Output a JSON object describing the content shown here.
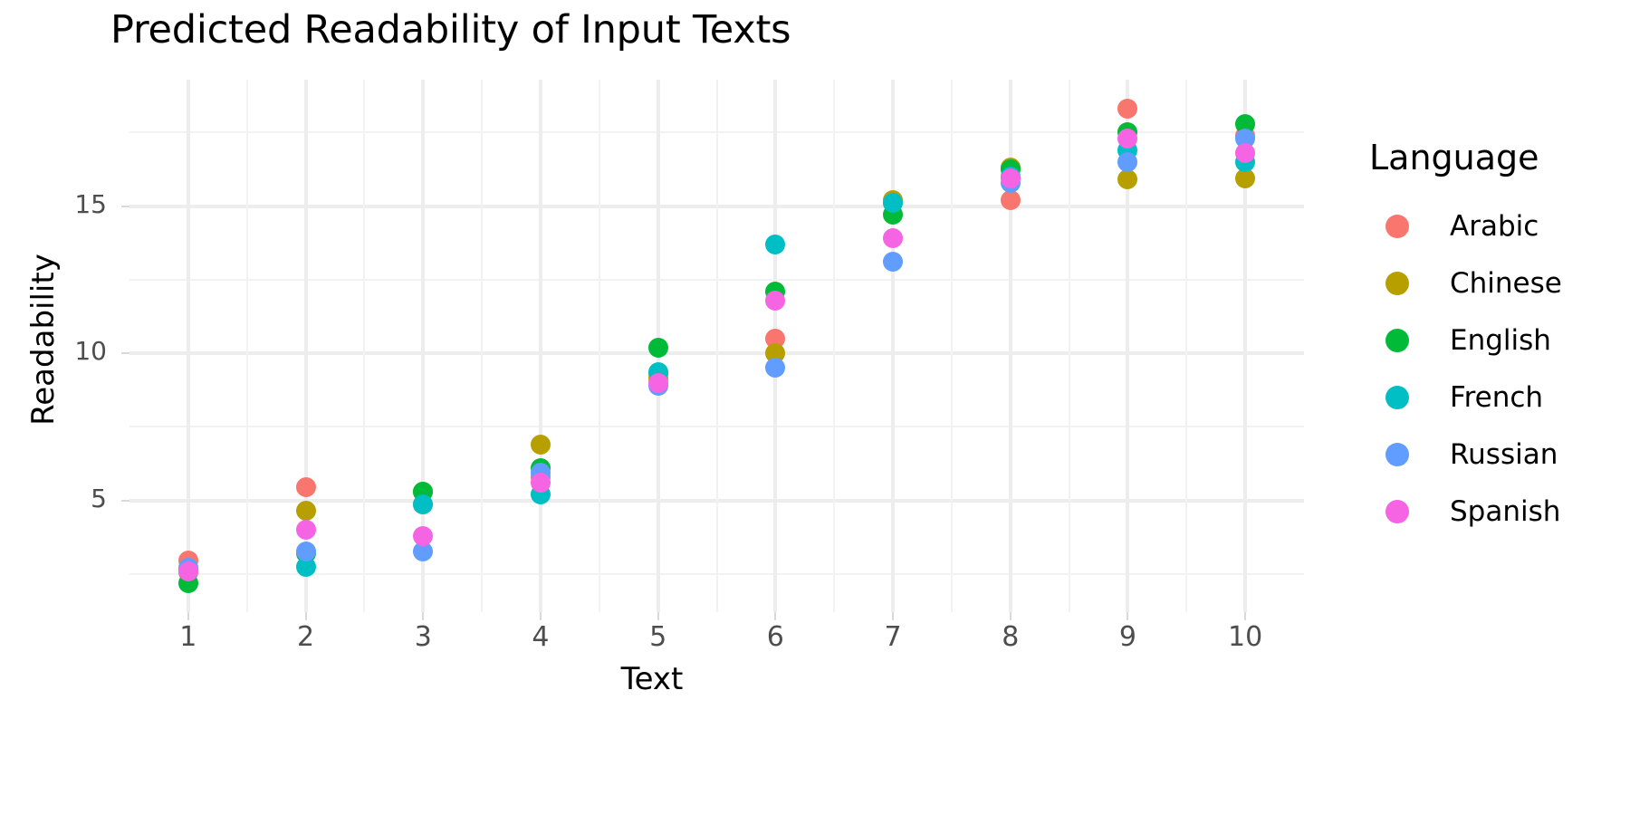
{
  "chart_data": {
    "type": "scatter",
    "title": "Predicted Readability of Input Texts",
    "xlabel": "Text",
    "ylabel": "Readability",
    "xlim": [
      0.5,
      10.5
    ],
    "ylim": [
      1.2,
      19.3
    ],
    "x_ticks": [
      "1",
      "2",
      "3",
      "4",
      "5",
      "6",
      "7",
      "8",
      "9",
      "10"
    ],
    "y_ticks": [
      "5",
      "10",
      "15"
    ],
    "y_tick_values": [
      5,
      10,
      15
    ],
    "y_minor_values": [
      2.5,
      7.5,
      12.5,
      17.5
    ],
    "grid": true,
    "legend_position": "right",
    "legend_title": "Language",
    "categories": [
      1,
      2,
      3,
      4,
      5,
      6,
      7,
      8,
      9,
      10
    ],
    "series": [
      {
        "name": "Arabic",
        "color": "#F8766D",
        "values": [
          2.95,
          5.45,
          4.85,
          5.8,
          9.3,
          10.5,
          15.1,
          15.2,
          18.3,
          17.4
        ]
      },
      {
        "name": "Chinese",
        "color": "#B79F00",
        "values": [
          2.55,
          4.65,
          5.3,
          6.9,
          9.15,
          10.0,
          15.2,
          16.3,
          15.9,
          15.95
        ]
      },
      {
        "name": "English",
        "color": "#00BA38",
        "values": [
          2.2,
          3.2,
          5.3,
          6.1,
          10.2,
          12.1,
          14.7,
          16.25,
          17.5,
          17.8
        ]
      },
      {
        "name": "French",
        "color": "#00BFC4",
        "values": [
          2.65,
          2.75,
          4.85,
          5.2,
          9.35,
          13.7,
          15.1,
          16.0,
          16.9,
          16.5
        ]
      },
      {
        "name": "Russian",
        "color": "#619CFF",
        "values": [
          2.7,
          3.25,
          3.25,
          5.95,
          8.9,
          9.5,
          13.1,
          15.8,
          16.5,
          17.3
        ]
      },
      {
        "name": "Spanish",
        "color": "#F564E3",
        "values": [
          2.6,
          4.0,
          3.8,
          5.6,
          9.0,
          11.8,
          13.9,
          15.95,
          17.3,
          16.8
        ]
      }
    ]
  },
  "legend": {
    "title": "Language",
    "items": [
      {
        "label": "Arabic",
        "color": "#F8766D"
      },
      {
        "label": "Chinese",
        "color": "#B79F00"
      },
      {
        "label": "English",
        "color": "#00BA38"
      },
      {
        "label": "French",
        "color": "#00BFC4"
      },
      {
        "label": "Russian",
        "color": "#619CFF"
      },
      {
        "label": "Spanish",
        "color": "#F564E3"
      }
    ]
  },
  "axes": {
    "x_title": "Text",
    "y_title": "Readability"
  },
  "colors": {
    "grid_major": "#EDEDED",
    "grid_minor": "#F2F2F2",
    "tick_text": "#4D4D4D",
    "title_text": "#000000",
    "background": "#FFFFFF"
  }
}
